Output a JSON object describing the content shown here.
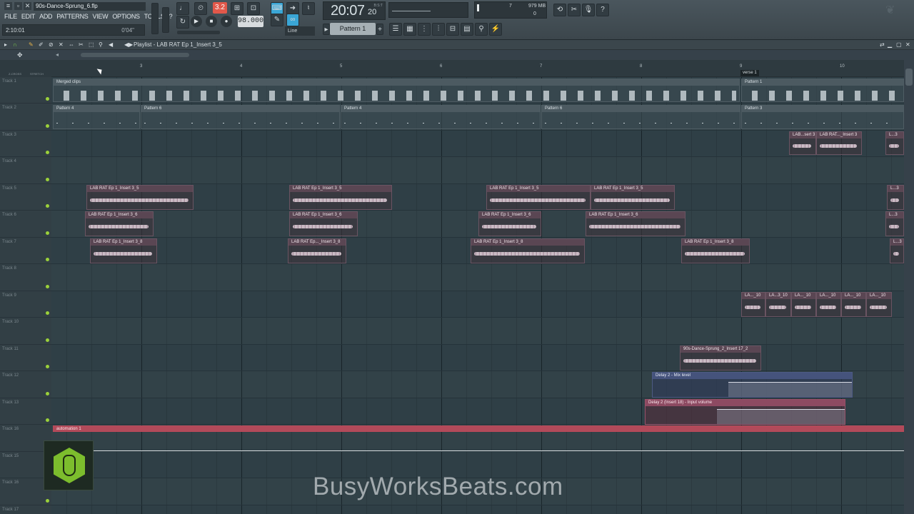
{
  "window": {
    "file_name": "90s-Dance-Sprung_6.flp",
    "hint_time": "2:10:01",
    "hint_right": "0'04\""
  },
  "menu": [
    "FILE",
    "EDIT",
    "ADD",
    "PATTERNS",
    "VIEW",
    "OPTIONS",
    "TOOLS",
    "?"
  ],
  "transport": {
    "song_mode_label": "3.2",
    "tempo": "98.000",
    "time": "20:07",
    "time_sub": "20",
    "time_unit": "B:S:T",
    "cpu": "7",
    "memory": "979 MB",
    "poly": "0",
    "pattern": "Pattern 1",
    "snap": "Line"
  },
  "playlist": {
    "title": "Playlist - LAB RAT Ep 1_Insert 3_5",
    "bar_numbers": [
      "3",
      "4",
      "5",
      "6",
      "7",
      "8",
      "9",
      "10"
    ],
    "marker": "verse 1",
    "left_labels": [
      "Z-CROSS",
      "STRETCH"
    ],
    "tracks": [
      "Track 1",
      "Track 2",
      "Track 3",
      "Track 4",
      "Track 5",
      "Track 6",
      "Track 7",
      "Track 8",
      "Track 9",
      "Track 10",
      "Track 11",
      "Track 12",
      "Track 13",
      "Track 14",
      "Track 15",
      "Track 16",
      "Track 17"
    ]
  },
  "clips": {
    "merged": "Merged clips",
    "pattern1": "Pattern 1",
    "pattern3": "Pattern 3",
    "pattern4": "Pattern 4",
    "pattern6": "Pattern 6",
    "insert35": "LAB RAT Ep 1_Insert 3_5",
    "insert36": "LAB RAT Ep 1_Insert 3_6",
    "insert38": "LAB RAT Ep 1_Insert 3_8",
    "insert38b": "LAB RAT Ep..._Insert 3_8",
    "t3a": "LAB...sert 3",
    "t3b": "LAB RAT..._Insert 3",
    "t3c": "L...3",
    "t9a": "LA..._10",
    "t9b": "LA...3_10",
    "t9c": "LA..._10",
    "t9d": "LA..._10",
    "t9e": "LA..._10",
    "t9f": "LA..._10",
    "t11": "90s-Dance-Sprung_2_Insert 17_2",
    "delay_mix": "Delay 2 - Mix level",
    "delay_input": "Delay 2 (Insert 18) - Input volume",
    "automation": "automation 1"
  },
  "watermark": "BusyWorksBeats.com"
}
